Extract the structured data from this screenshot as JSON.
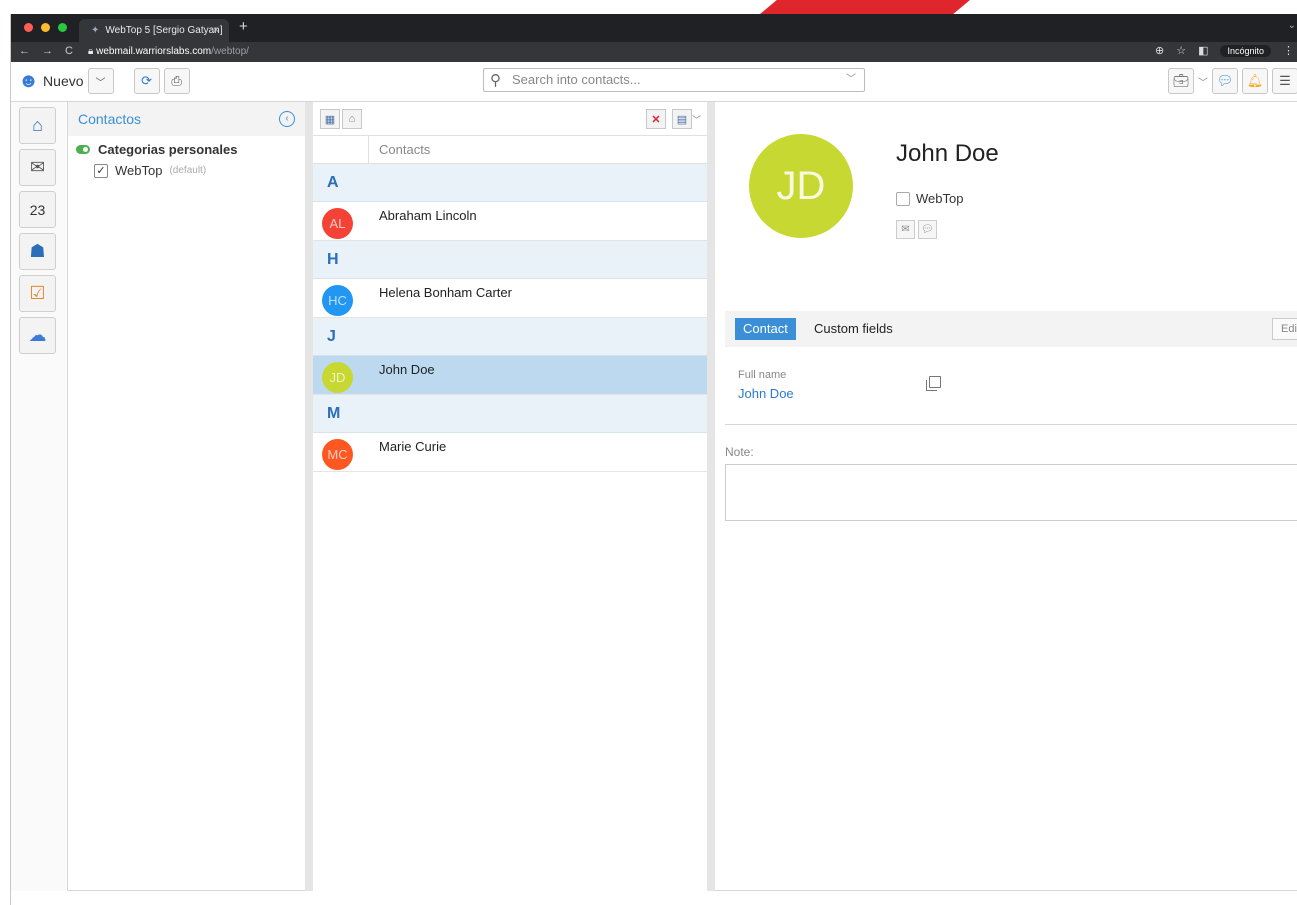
{
  "browser": {
    "tab_title": "WebTop 5 [Sergio Gatyan]",
    "tab_close": "×",
    "new_tab": "+",
    "url_host": "webmail.warriorslabs.com",
    "url_path": "/webtop/",
    "incognito_label": "Incógnito"
  },
  "toolbar": {
    "new_label": "Nuevo",
    "search_placeholder": "Search into contacts..."
  },
  "categories": {
    "header": "Contactos",
    "group_title": "Categorias personales",
    "items": [
      {
        "label": "WebTop",
        "note": "(default)",
        "checked": true
      }
    ]
  },
  "list": {
    "column_header": "Contacts",
    "groups": [
      {
        "letter": "A",
        "contacts": [
          {
            "initials": "AL",
            "name": "Abraham Lincoln",
            "color": "#f44336"
          }
        ]
      },
      {
        "letter": "H",
        "contacts": [
          {
            "initials": "HC",
            "name": "Helena Bonham Carter",
            "color": "#2196f3"
          }
        ]
      },
      {
        "letter": "J",
        "contacts": [
          {
            "initials": "JD",
            "name": "John Doe",
            "color": "#c8d832",
            "selected": true
          }
        ]
      },
      {
        "letter": "M",
        "contacts": [
          {
            "initials": "MC",
            "name": "Marie Curie",
            "color": "#ff5722"
          }
        ]
      }
    ]
  },
  "detail": {
    "initials": "JD",
    "name": "John Doe",
    "category": "WebTop",
    "tabs": {
      "active": "Contact",
      "other": "Custom fields"
    },
    "edit_label": "Edit",
    "full_name_label": "Full name",
    "full_name_value": "John Doe",
    "note_label": "Note:",
    "avatar_color": "#c8d832"
  },
  "colors": {
    "accent": "#3a8fd6",
    "selected_row": "#bcd9f0"
  }
}
